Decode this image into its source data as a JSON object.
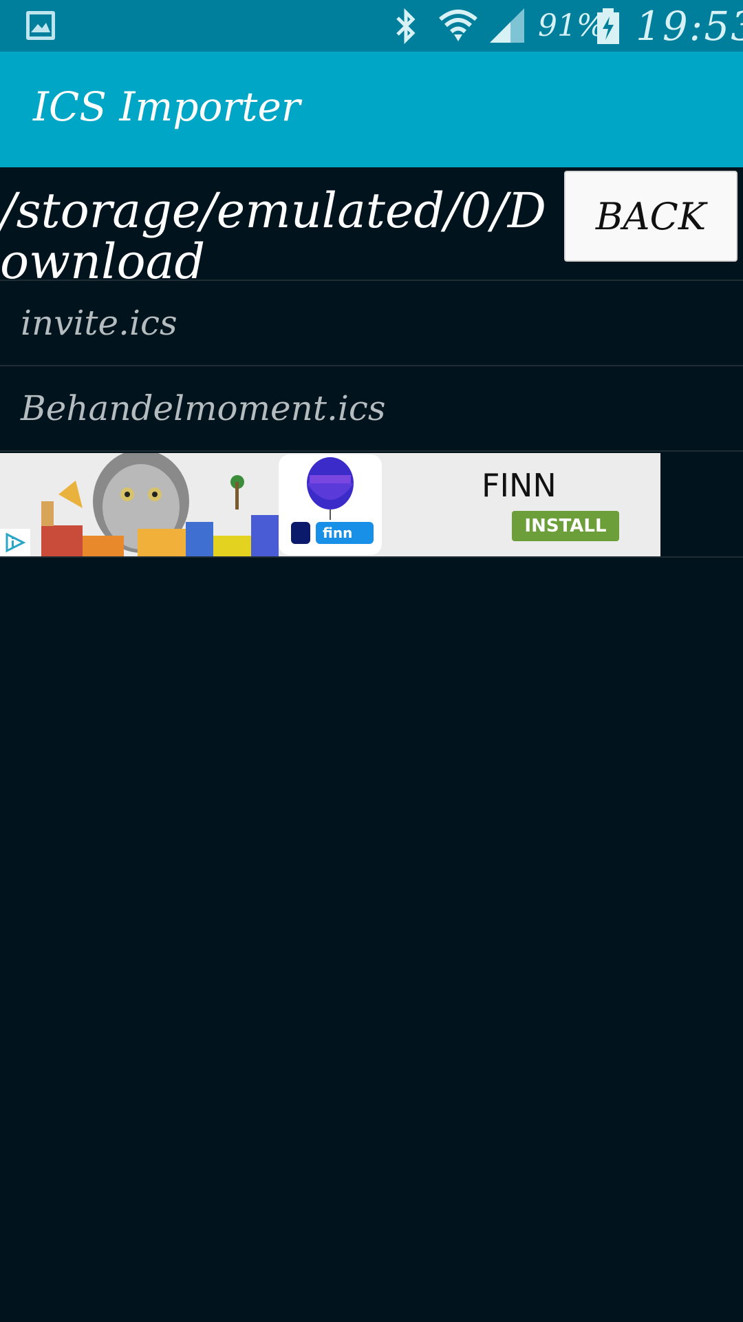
{
  "status_bar": {
    "battery_percent": "91%",
    "time": "19:53",
    "icons": [
      "gallery-icon",
      "bluetooth-icon",
      "wifi-icon",
      "signal-icon",
      "battery-charging-icon"
    ]
  },
  "app": {
    "title": "ICS Importer"
  },
  "browser": {
    "path": "/storage/emulated/0/Download",
    "back_label": "BACK",
    "files": [
      {
        "name": "invite.ics"
      },
      {
        "name": "Behandelmoment.ics"
      }
    ]
  },
  "ad": {
    "app_name": "FINN",
    "install_label": "INSTALL",
    "logo_text": "finn"
  },
  "colors": {
    "status_bar": "#007f9c",
    "action_bar": "#00a6c5",
    "background": "#01131c",
    "install_green": "#6c9e3a"
  }
}
